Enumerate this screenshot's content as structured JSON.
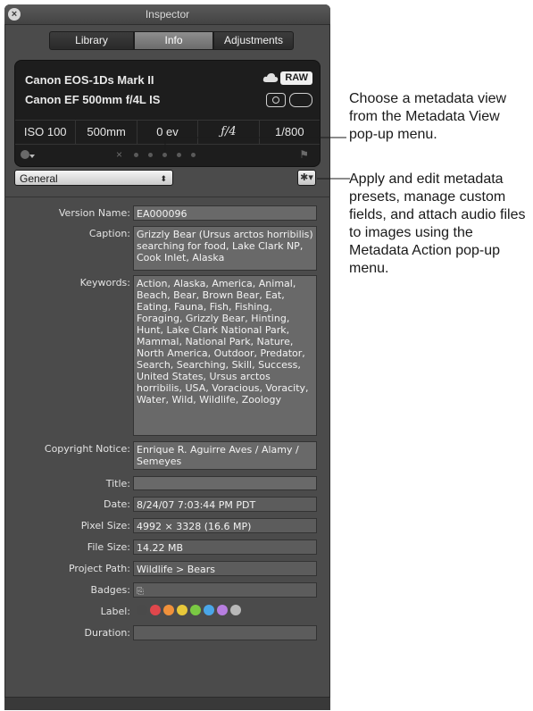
{
  "window": {
    "title": "Inspector"
  },
  "tabs": [
    {
      "label": "Library",
      "active": false
    },
    {
      "label": "Info",
      "active": true
    },
    {
      "label": "Adjustments",
      "active": false
    }
  ],
  "camera": {
    "model": "Canon EOS-1Ds Mark II",
    "lens": "Canon EF 500mm f/4L IS",
    "format_badge": "RAW",
    "stats": {
      "iso": "ISO 100",
      "focal_length": "500mm",
      "exposure": "0 ev",
      "aperture": "ƒ/4",
      "shutter": "1/800"
    }
  },
  "metadata_view": {
    "selected": "General"
  },
  "fields": {
    "version_name": {
      "label": "Version Name:",
      "value": "EA000096"
    },
    "caption": {
      "label": "Caption:",
      "value": "Grizzly Bear (Ursus arctos horribilis) searching for food, Lake Clark NP, Cook Inlet, Alaska"
    },
    "keywords": {
      "label": "Keywords:",
      "value": "Action, Alaska, America, Animal, Beach, Bear, Brown Bear, Eat, Eating, Fauna, Fish, Fishing, Foraging, Grizzly Bear, Hinting, Hunt, Lake Clark National Park, Mammal, National Park, Nature, North America, Outdoor, Predator, Search, Searching, Skill, Success, United States, Ursus arctos horribilis, USA, Voracious, Voracity, Water, Wild, Wildlife, Zoology"
    },
    "copyright": {
      "label": "Copyright Notice:",
      "value": "Enrique R. Aguirre Aves / Alamy / Semeyes"
    },
    "title": {
      "label": "Title:",
      "value": ""
    },
    "date": {
      "label": "Date:",
      "value": "8/24/07 7:03:44 PM PDT"
    },
    "pixel_size": {
      "label": "Pixel Size:",
      "value": "4992 × 3328 (16.6 MP)"
    },
    "file_size": {
      "label": "File Size:",
      "value": "14.22 MB"
    },
    "project_path": {
      "label": "Project Path:",
      "value": "Wildlife > Bears"
    },
    "badges": {
      "label": "Badges:"
    },
    "label": {
      "label": "Label:"
    },
    "duration": {
      "label": "Duration:",
      "value": ""
    }
  },
  "label_colors": [
    "#4a4a4a",
    "#e0474c",
    "#f0913b",
    "#e8c83a",
    "#7ac943",
    "#4aa6e8",
    "#b77ee0",
    "#b8b8b8"
  ],
  "callouts": {
    "metadata_view": "Choose a metadata view from the Metadata View pop-up menu.",
    "metadata_action": "Apply and edit metadata presets, manage custom fields, and attach audio files to images using the Metadata Action pop-up menu."
  }
}
